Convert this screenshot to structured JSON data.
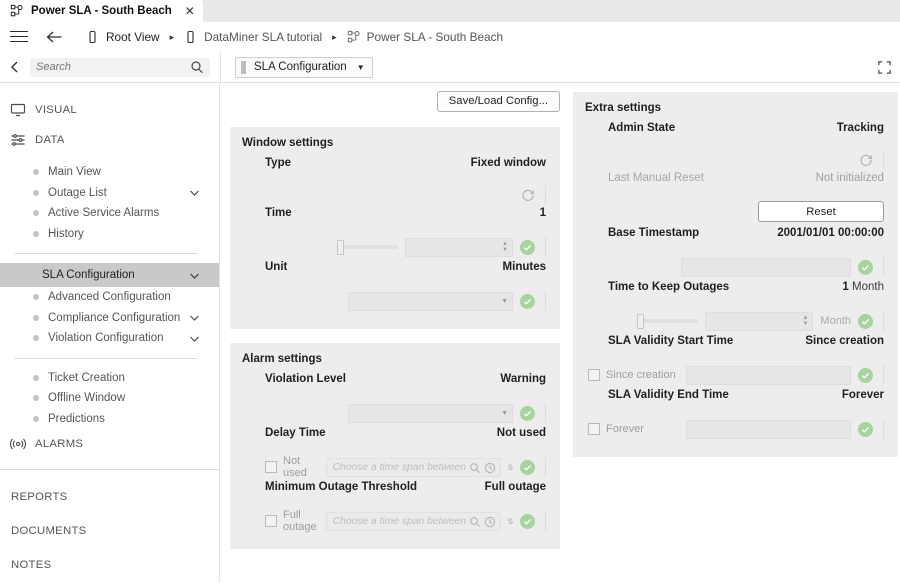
{
  "tab": {
    "title": "Power SLA - South Beach",
    "icon": "service-topology-icon",
    "close_icon": "close-icon"
  },
  "breadcrumb": {
    "menu_icon": "hamburger-menu-icon",
    "back_icon": "back-arrow-icon",
    "items": [
      {
        "label": "Root View",
        "icon": "view-icon"
      },
      {
        "label": "DataMiner SLA tutorial",
        "icon": "view-icon"
      },
      {
        "label": "Power SLA - South Beach",
        "icon": "service-topology-icon"
      }
    ],
    "separator": "▸"
  },
  "toolbar": {
    "collapse_icon": "chevron-left-icon",
    "search_placeholder": "Search",
    "search_value": "",
    "search_icon": "search-icon",
    "config_select": {
      "label": "SLA Configuration",
      "caret": "▼"
    },
    "fullscreen_icon": "fullscreen-icon"
  },
  "sidebar": {
    "sections": [
      {
        "label": "VISUAL",
        "icon": "monitor-icon"
      },
      {
        "label": "DATA",
        "icon": "sliders-icon"
      }
    ],
    "group1": [
      {
        "label": "Main View",
        "expandable": false
      },
      {
        "label": "Outage List",
        "expandable": true
      },
      {
        "label": "Active Service Alarms",
        "expandable": false
      },
      {
        "label": "History",
        "expandable": false
      }
    ],
    "group2": [
      {
        "label": "SLA Configuration",
        "expandable": true,
        "selected": true
      },
      {
        "label": "Advanced Configuration",
        "expandable": false,
        "selected": false
      },
      {
        "label": "Compliance Configuration",
        "expandable": true,
        "selected": false
      },
      {
        "label": "Violation Configuration",
        "expandable": true,
        "selected": false
      }
    ],
    "group3": [
      {
        "label": "Ticket Creation",
        "expandable": false
      },
      {
        "label": "Offline Window",
        "expandable": false
      },
      {
        "label": "Predictions",
        "expandable": false
      }
    ],
    "alarms": {
      "label": "ALARMS",
      "icon": "alarm-bell-icon"
    },
    "footer": [
      {
        "label": "REPORTS"
      },
      {
        "label": "DOCUMENTS"
      },
      {
        "label": "NOTES"
      }
    ]
  },
  "content": {
    "save_load_button": "Save/Load Config...",
    "window_settings": {
      "title": "Window settings",
      "type": {
        "label": "Type",
        "value": "Fixed window"
      },
      "time": {
        "label": "Time",
        "value": "1"
      },
      "unit": {
        "label": "Unit",
        "value": "Minutes"
      }
    },
    "alarm_settings": {
      "title": "Alarm settings",
      "violation_level": {
        "label": "Violation Level",
        "value": "Warning"
      },
      "delay_time": {
        "label": "Delay Time",
        "value": "Not used",
        "checkbox_label": "Not used",
        "input_placeholder": "Choose a time span between",
        "unit": "s"
      },
      "minimum_outage_threshold": {
        "label": "Minimum Outage Threshold",
        "value": "Full outage",
        "checkbox_label": "Full outage",
        "input_placeholder": "Choose a time span between",
        "unit": "s"
      }
    },
    "extra_settings": {
      "title": "Extra settings",
      "admin_state": {
        "label": "Admin State",
        "value": "Tracking"
      },
      "last_manual_reset": {
        "label": "Last Manual Reset",
        "value": "Not initialized"
      },
      "reset_button": "Reset",
      "base_timestamp": {
        "label": "Base Timestamp",
        "value": "2001/01/01 00:00:00"
      },
      "time_to_keep_outages": {
        "label": "Time to Keep Outages",
        "value": "1",
        "value_unit": "Month",
        "unit_label": "Month"
      },
      "sla_validity_start": {
        "label": "SLA Validity Start Time",
        "value": "Since creation",
        "checkbox_label": "Since creation"
      },
      "sla_validity_end": {
        "label": "SLA Validity End Time",
        "value": "Forever",
        "checkbox_label": "Forever"
      }
    }
  },
  "colors": {
    "panel_bg": "#ededed",
    "selected_nav": "#c9c9c9",
    "check_green": "#a8d2a0",
    "accent_bar": "#cfe0ee"
  }
}
